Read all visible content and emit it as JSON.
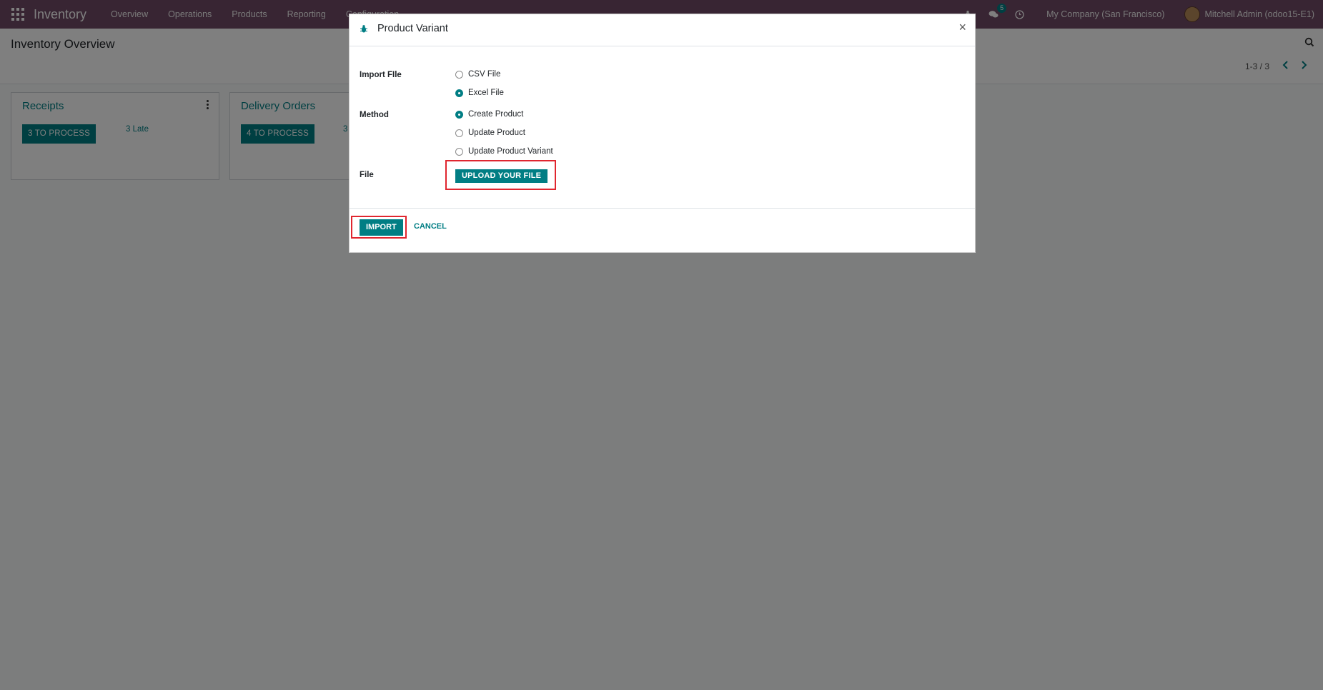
{
  "navbar": {
    "app_name": "Inventory",
    "menu": [
      "Overview",
      "Operations",
      "Products",
      "Reporting",
      "Configuration"
    ],
    "chat_badge": "5",
    "company": "My Company (San Francisco)",
    "user": "Mitchell Admin (odoo15-E1)"
  },
  "control_panel": {
    "title": "Inventory Overview",
    "pager": "1-3 / 3"
  },
  "kanban": {
    "cards": [
      {
        "title": "Receipts",
        "button": "3 TO PROCESS",
        "late": "3 Late"
      },
      {
        "title": "Delivery Orders",
        "button": "4 TO PROCESS",
        "late": "3"
      }
    ]
  },
  "modal": {
    "title": "Product Variant",
    "close": "×",
    "import_file_label": "Import FIle",
    "import_file_options": [
      {
        "label": "CSV File",
        "checked": false
      },
      {
        "label": "Excel File",
        "checked": true
      }
    ],
    "method_label": "Method",
    "method_options": [
      {
        "label": "Create Product",
        "checked": true
      },
      {
        "label": "Update Product",
        "checked": false
      },
      {
        "label": "Update Product Variant",
        "checked": false
      }
    ],
    "file_label": "File",
    "upload_button": "UPLOAD YOUR FILE",
    "import_button": "IMPORT",
    "cancel_button": "CANCEL"
  },
  "colors": {
    "navbar": "#714b67",
    "primary": "#017e84",
    "highlight": "#e0262f"
  }
}
